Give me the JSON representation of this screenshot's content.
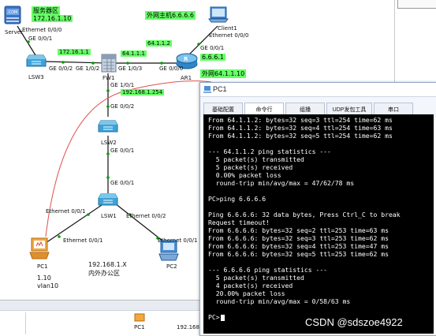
{
  "topology": {
    "labels": {
      "server_zone": "服务器区",
      "server_ip": "172.16.1.10",
      "external_host": "外网主机6.6.6.6",
      "link_lsw3_fw": "172.16.1.1",
      "link_fw_ar1_fw": "64.1.1.1",
      "link_fw_ar1_ar": "64.1.1.2",
      "ar1_client": "6.6.6.1",
      "external_net": "外网64.1.1.10",
      "fw_inside": "192.168.1.254",
      "office_net": "192.168.1.X",
      "office_zone": "内外办公区",
      "pc1_ip": "1.10",
      "pc1_vlan": "vlan10"
    },
    "devices": {
      "server": "Server",
      "client1": "Client1",
      "lsw3": "LSW3",
      "fw1": "FW1",
      "ar1": "AR1",
      "lsw2": "LSW2",
      "lsw1": "LSW1",
      "pc1": "PC1",
      "pc2": "PC2"
    },
    "ports": {
      "server_e": "Ethernet 0/0/0",
      "lsw3_g1": "GE 0/0/1",
      "lsw3_g2": "GE 0/0/2",
      "fw_g02": "GE 1/0/2",
      "fw_g03": "GE 1/0/3",
      "ar_g0": "GE 0/0/0",
      "ar_g1": "GE 0/0/1",
      "client_e": "Ethernet 0/0/0",
      "fw_g01": "GE 1/0/1",
      "lsw2_g2": "GE 0/0/2",
      "lsw2_g1": "GE 0/0/1",
      "lsw1_g1": "GE 0/0/1",
      "lsw1_e1": "Ethernet 0/0/1",
      "lsw1_e2": "Ethernet 0/0/2",
      "pc1_e": "Ethernet 0/0/1",
      "pc2_e": "Ethernet 0/0/1"
    }
  },
  "bottom_strip": {
    "pc1": "PC1",
    "ip": "192.168"
  },
  "pc_window": {
    "title": "PC1",
    "tabs": [
      "基础配置",
      "命令行",
      "组播",
      "UDP发包工具",
      "串口"
    ],
    "active_tab": "命令行",
    "terminal_lines": [
      "From 64.1.1.2: bytes=32 seq=3 ttl=254 time=62 ms",
      "From 64.1.1.2: bytes=32 seq=4 ttl=254 time=63 ms",
      "From 64.1.1.2: bytes=32 seq=5 ttl=254 time=62 ms",
      "",
      "--- 64.1.1.2 ping statistics ---",
      "  5 packet(s) transmitted",
      "  5 packet(s) received",
      "  0.00% packet loss",
      "  round-trip min/avg/max = 47/62/78 ms",
      "",
      "PC>ping 6.6.6.6",
      "",
      "Ping 6.6.6.6: 32 data bytes, Press Ctrl_C to break",
      "Request timeout!",
      "From 6.6.6.6: bytes=32 seq=2 ttl=253 time=63 ms",
      "From 6.6.6.6: bytes=32 seq=3 ttl=253 time=62 ms",
      "From 6.6.6.6: bytes=32 seq=4 ttl=253 time=47 ms",
      "From 6.6.6.6: bytes=32 seq=5 ttl=253 time=62 ms",
      "",
      "--- 6.6.6.6 ping statistics ---",
      "  5 packet(s) transmitted",
      "  4 packet(s) received",
      "  20.00% packet loss",
      "  round-trip min/avg/max = 0/58/63 ms",
      "",
      "PC>"
    ]
  },
  "watermark": "CSDN @sdszoe4922",
  "colors": {
    "label_bg": "#66ff66",
    "link": "#111111",
    "red_link": "#e0504a",
    "terminal_bg": "#000000",
    "terminal_fg": "#ffffff",
    "switch_blue": "#3ea3d8"
  }
}
